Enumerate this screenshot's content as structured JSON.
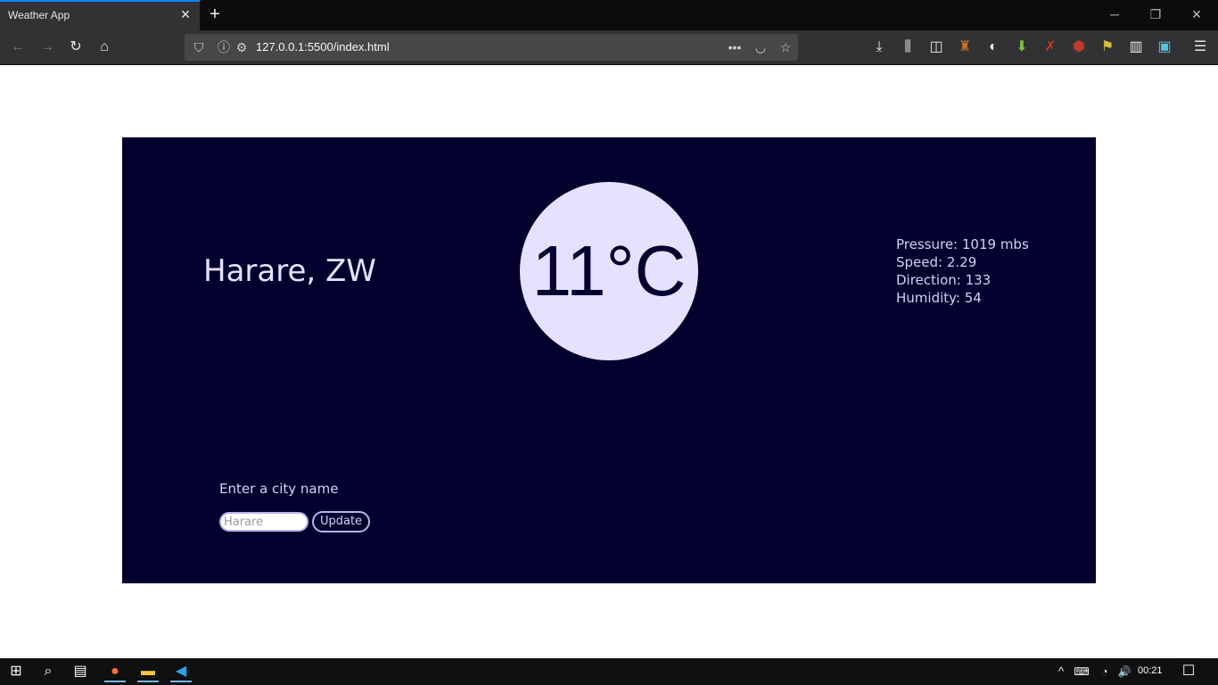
{
  "browser": {
    "tab_title": "Weather App",
    "url": "127.0.0.1:5500/index.html"
  },
  "app": {
    "city": "Harare, ZW",
    "temperature": "11°C",
    "stats": {
      "pressure": "Pressure: 1019 mbs",
      "speed": "Speed: 2.29",
      "direction": "Direction: 133",
      "humidity": "Humidity: 54"
    },
    "form": {
      "label": "Enter a city name",
      "input_placeholder": "Harare",
      "button_label": "Update"
    },
    "colors": {
      "background": "#04002e",
      "accent": "#e5e1ff"
    }
  },
  "taskbar": {
    "clock": "00:21"
  }
}
